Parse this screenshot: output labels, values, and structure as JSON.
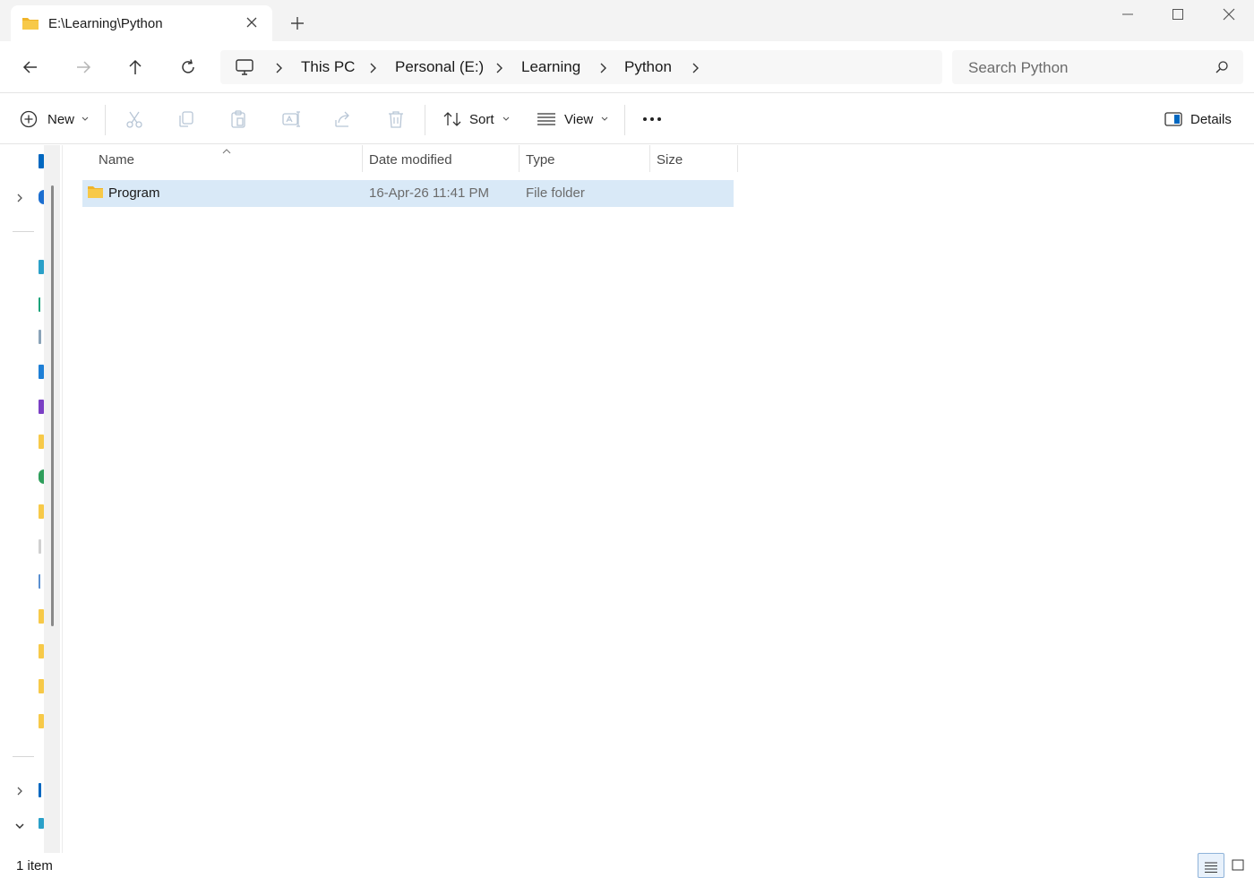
{
  "window": {
    "tab_title": "E:\\Learning\\Python",
    "new_tab_icon": "plus-icon",
    "controls": [
      "minimize-icon",
      "maximize-icon",
      "close-icon"
    ]
  },
  "nav": {
    "back_icon": "arrow-left-icon",
    "forward_icon": "arrow-right-icon",
    "up_icon": "arrow-up-icon",
    "refresh_icon": "refresh-icon"
  },
  "breadcrumb": {
    "root_icon": "monitor-icon",
    "items": [
      "This PC",
      "Personal (E:)",
      "Learning",
      "Python"
    ]
  },
  "search": {
    "placeholder": "Search Python",
    "icon": "search-icon"
  },
  "commands": {
    "new_label": "New",
    "sort_label": "Sort",
    "view_label": "View",
    "details_label": "Details",
    "disabled_icons": [
      "cut-icon",
      "copy-icon",
      "paste-icon",
      "rename-icon",
      "share-icon",
      "delete-icon"
    ],
    "more_icon": "more-icon"
  },
  "table": {
    "columns": [
      "Name",
      "Date modified",
      "Type",
      "Size"
    ],
    "rows": [
      {
        "name": "Program",
        "date": "16-Apr-26 11:41 PM",
        "type": "File folder",
        "size": ""
      }
    ]
  },
  "status": {
    "item_count": "1 item"
  },
  "colors": {
    "selection": "#d9e9f7",
    "folder": "#f7c948",
    "accent": "#0067c0"
  }
}
